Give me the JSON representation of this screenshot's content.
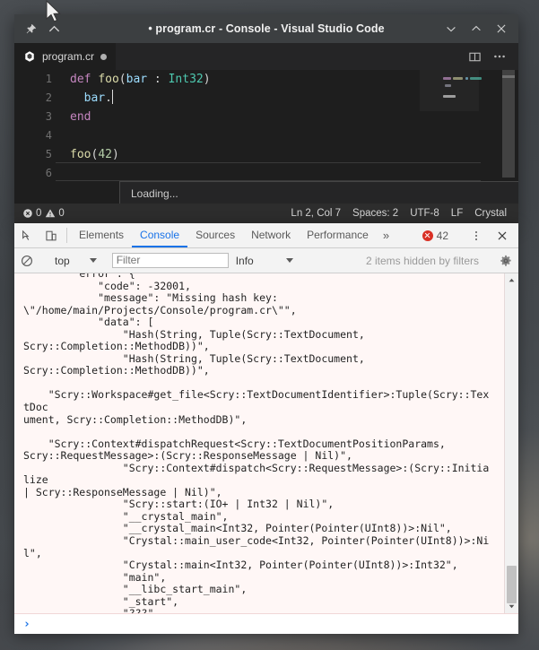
{
  "window": {
    "title": "• program.cr - Console - Visual Studio Code",
    "pin_icon": "pin-icon",
    "collapse_icon": "chevron-up-icon",
    "minimize_icon": "chevron-down-icon",
    "maximize_icon": "chevron-up-icon",
    "close_icon": "close-icon"
  },
  "tabbar": {
    "tab_label": "program.cr",
    "file_icon": "crystal-file-icon",
    "dirty_indicator": "unsaved-dot",
    "split_editor_icon": "split-editor-icon",
    "more_actions_icon": "more-actions-icon"
  },
  "editor": {
    "lines": [
      {
        "num": "1",
        "tokens": [
          {
            "t": "def ",
            "c": "k-def"
          },
          {
            "t": "foo",
            "c": "k-fn"
          },
          {
            "t": "(",
            "c": "k-punc"
          },
          {
            "t": "bar",
            "c": "k-var"
          },
          {
            "t": " : ",
            "c": "k-punc"
          },
          {
            "t": "Int32",
            "c": "k-type"
          },
          {
            "t": ")",
            "c": "k-punc"
          }
        ]
      },
      {
        "num": "2",
        "tokens": [
          {
            "t": "  ",
            "c": "k-punc"
          },
          {
            "t": "bar",
            "c": "k-var"
          },
          {
            "t": ".",
            "c": "k-punc"
          }
        ],
        "caret": true
      },
      {
        "num": "3",
        "tokens": [
          {
            "t": "end",
            "c": "k-def"
          }
        ]
      },
      {
        "num": "4",
        "tokens": []
      },
      {
        "num": "5",
        "tokens": [
          {
            "t": "foo",
            "c": "k-fn"
          },
          {
            "t": "(",
            "c": "k-punc"
          },
          {
            "t": "42",
            "c": "k-num"
          },
          {
            "t": ")",
            "c": "k-punc"
          }
        ]
      },
      {
        "num": "6",
        "tokens": []
      }
    ],
    "suggestion_widget_text": "Loading...",
    "cursor_position": "Ln 2, Col 7"
  },
  "statusbar": {
    "error_icon": "error-circle-icon",
    "error_count": "0",
    "warning_icon": "warning-triangle-icon",
    "warning_count": "0",
    "position": "Ln 2, Col 7",
    "indentation": "Spaces: 2",
    "encoding": "UTF-8",
    "eol": "LF",
    "language": "Crystal"
  },
  "devtools": {
    "inspect_icon": "inspect-element-icon",
    "device_toolbar_icon": "device-toolbar-icon",
    "tabs": [
      {
        "label": "Elements",
        "active": false
      },
      {
        "label": "Console",
        "active": true
      },
      {
        "label": "Sources",
        "active": false
      },
      {
        "label": "Network",
        "active": false
      },
      {
        "label": "Performance",
        "active": false
      }
    ],
    "more_tabs_icon": "chevron-double-right-icon",
    "error_badge_icon": "error-circle-icon",
    "error_badge_count": "42",
    "kebab_icon": "more-options-icon",
    "close_icon": "close-icon",
    "filterbar": {
      "clear_console_icon": "clear-console-icon",
      "context": "top",
      "context_caret_icon": "chevron-down-icon",
      "filter_placeholder": "Filter",
      "filter_value": "",
      "level": "Info",
      "level_caret_icon": "chevron-down-icon",
      "hidden_note": "2 items hidden by filters",
      "settings_icon": "gear-icon"
    },
    "console_log": "        \"error\": {\n            \"code\": -32001,\n            \"message\": \"Missing hash key:\n\\\"/home/main/Projects/Console/program.cr\\\"\",\n            \"data\": [\n                \"Hash(String, Tuple(Scry::TextDocument,\nScry::Completion::MethodDB))\",\n                \"Hash(String, Tuple(Scry::TextDocument,\nScry::Completion::MethodDB))\",\n\n    \"Scry::Workspace#get_file<Scry::TextDocumentIdentifier>:Tuple(Scry::TextDoc\nument, Scry::Completion::MethodDB)\",\n\n    \"Scry::Context#dispatchRequest<Scry::TextDocumentPositionParams,\nScry::RequestMessage>:(Scry::ResponseMessage | Nil)\",\n                \"Scry::Context#dispatch<Scry::RequestMessage>:(Scry::Initialize\n| Scry::ResponseMessage | Nil)\",\n                \"Scry::start:(IO+ | Int32 | Nil)\",\n                \"__crystal_main\",\n                \"__crystal_main<Int32, Pointer(Pointer(UInt8))>:Nil\",\n                \"Crystal::main_user_code<Int32, Pointer(Pointer(UInt8))>:Nil\",\n                \"Crystal::main<Int32, Pointer(Pointer(UInt8))>:Int32\",\n                \"main\",\n                \"__libc_start_main\",\n                \"_start\",\n                \"???\"\n            ]\n        }\n    }",
    "prompt_symbol": "›",
    "prompt_value": "",
    "scrollbar_up_icon": "scroll-up-arrow-icon",
    "scrollbar_down_icon": "scroll-down-arrow-icon"
  },
  "colors": {
    "accent_blue": "#1a73e8",
    "error_red": "#d93025",
    "console_bg": "#fff7f6",
    "editor_bg": "#1e1e1e",
    "titlebar_bg": "#3c3f41"
  }
}
